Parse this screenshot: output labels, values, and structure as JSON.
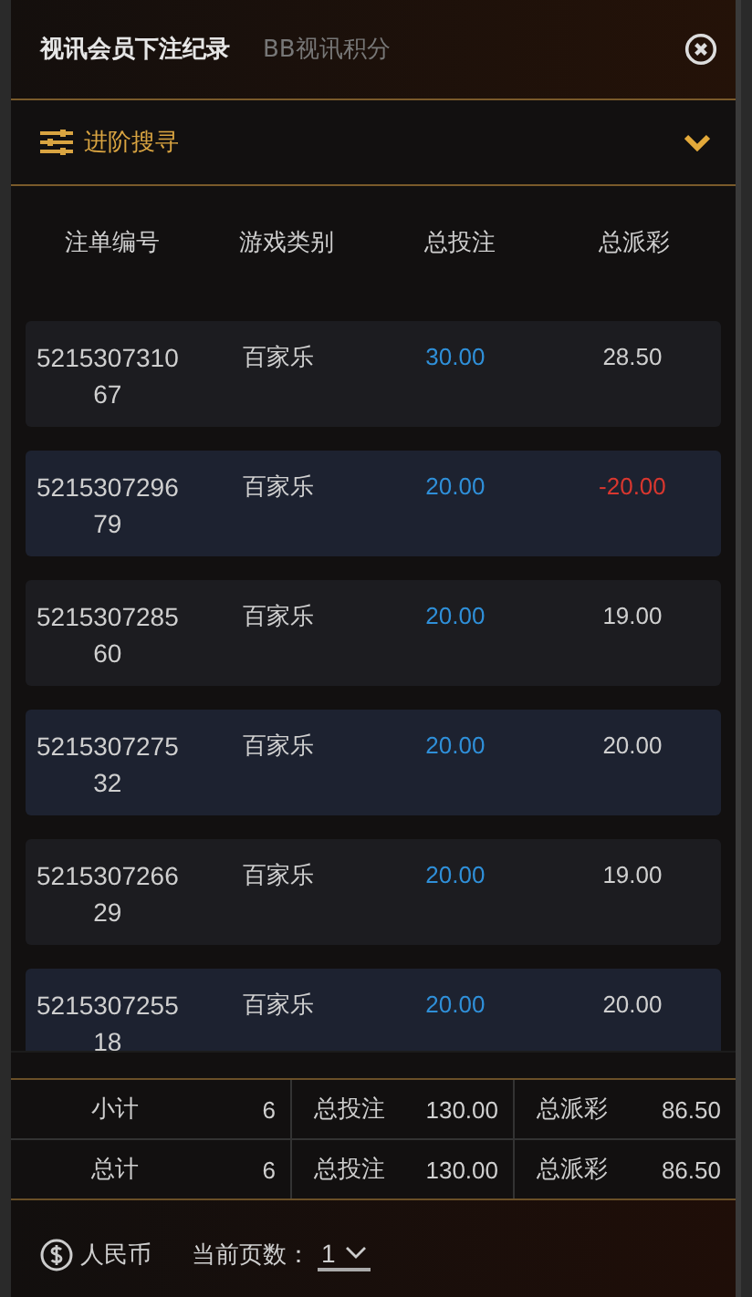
{
  "tabs": [
    {
      "label": "视讯会员下注纪录",
      "selected": true
    },
    {
      "label": "BB视讯积分",
      "selected": false
    }
  ],
  "filter": {
    "label": "进阶搜寻",
    "expanded": false
  },
  "table": {
    "columns": [
      "注单编号",
      "游戏类别",
      "总投注",
      "总派彩"
    ],
    "rows": [
      {
        "id": "521530731067",
        "game": "百家乐",
        "bet": "30.00",
        "payout": "28.50",
        "negative": false
      },
      {
        "id": "521530729679",
        "game": "百家乐",
        "bet": "20.00",
        "payout": "-20.00",
        "negative": true
      },
      {
        "id": "521530728560",
        "game": "百家乐",
        "bet": "20.00",
        "payout": "19.00",
        "negative": false
      },
      {
        "id": "521530727532",
        "game": "百家乐",
        "bet": "20.00",
        "payout": "20.00",
        "negative": false
      },
      {
        "id": "521530726629",
        "game": "百家乐",
        "bet": "20.00",
        "payout": "19.00",
        "negative": false
      },
      {
        "id": "521530725518",
        "game": "百家乐",
        "bet": "20.00",
        "payout": "20.00",
        "negative": false
      }
    ]
  },
  "summary": [
    {
      "label": "小计",
      "count": "6",
      "bet_label": "总投注",
      "bet": "130.00",
      "payout_label": "总派彩",
      "payout": "86.50"
    },
    {
      "label": "总计",
      "count": "6",
      "bet_label": "总投注",
      "bet": "130.00",
      "payout_label": "总派彩",
      "payout": "86.50"
    }
  ],
  "footer": {
    "currency": "人民币",
    "page_label": "当前页数：",
    "page": "1"
  }
}
